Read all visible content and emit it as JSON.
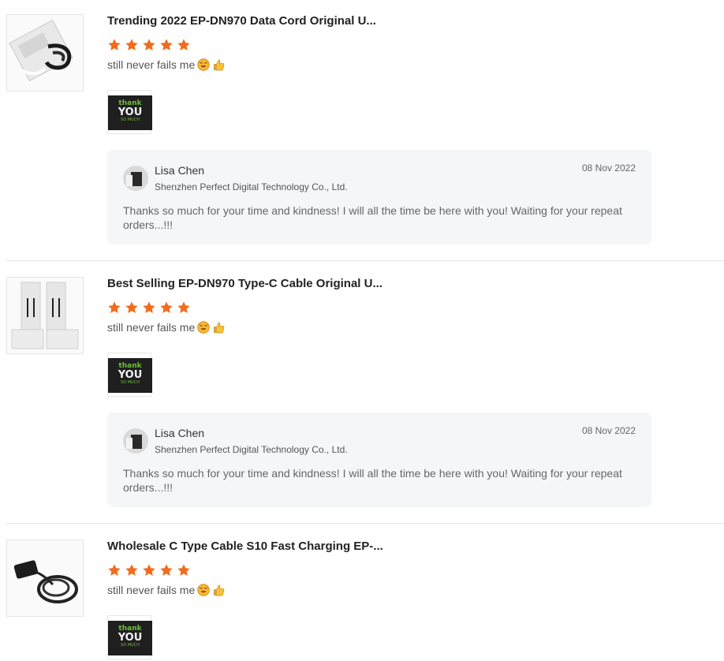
{
  "colors": {
    "star": "#f26b1d",
    "reply_bg": "#f5f6f8",
    "divider": "#e3e3e3"
  },
  "reviews": [
    {
      "title": "Trending 2022 EP-DN970 Data Cord Original U...",
      "rating": 5,
      "comment": "still never fails me",
      "emojis": [
        "smiling-face-with-hearts-icon",
        "thumbs-up-icon"
      ],
      "photo": {
        "line1": "thank",
        "line2": "YOU",
        "line3": "SO MUCH"
      },
      "reply": {
        "name": "Lisa Chen",
        "company": "Shenzhen Perfect Digital Technology Co., Ltd.",
        "date": "08 Nov 2022",
        "text": "Thanks so much for your time and kindness! I will all the time be here with you! Waiting for your repeat orders...!!!"
      }
    },
    {
      "title": "Best Selling EP-DN970 Type-C Cable Original U...",
      "rating": 5,
      "comment": "still never fails me",
      "emojis": [
        "smiling-face-with-hearts-icon",
        "thumbs-up-icon"
      ],
      "photo": {
        "line1": "thank",
        "line2": "YOU",
        "line3": "SO MUCH"
      },
      "reply": {
        "name": "Lisa Chen",
        "company": "Shenzhen Perfect Digital Technology Co., Ltd.",
        "date": "08 Nov 2022",
        "text": "Thanks so much for your time and kindness! I will all the time be here with you! Waiting for your repeat orders...!!!"
      }
    },
    {
      "title": "Wholesale C Type Cable S10 Fast Charging EP-...",
      "rating": 5,
      "comment": "still never fails me",
      "emojis": [
        "smiling-face-with-hearts-icon",
        "thumbs-up-icon"
      ],
      "photo": {
        "line1": "thank",
        "line2": "YOU",
        "line3": "SO MUCH"
      }
    }
  ]
}
